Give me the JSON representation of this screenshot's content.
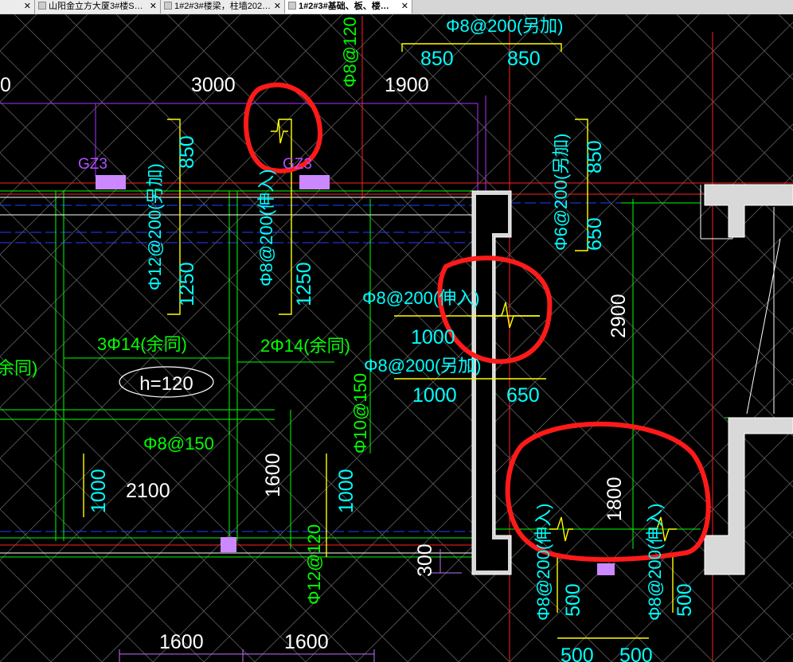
{
  "tabs": [
    {
      "label": "",
      "active": false
    },
    {
      "label": "山阳金立方大厦3#楼S…",
      "active": false
    },
    {
      "label": "1#2#3#楼梁，柱墙202…",
      "active": false
    },
    {
      "label": "1#2#3#基础、板、楼…",
      "active": false
    }
  ],
  "close_glyph": "✕",
  "dims": {
    "d0": "0",
    "d3000": "3000",
    "d1900": "1900",
    "d850a": "850",
    "d850b": "850",
    "d850c": "850",
    "d850d": "850",
    "d1250a": "1250",
    "d1250b": "1250",
    "d650a": "650",
    "d2900": "2900",
    "d1000a": "1000",
    "d1000b": "1000",
    "d650b": "650",
    "d2100": "2100",
    "d1600v": "1600",
    "d1000c": "1000",
    "d1000d": "1000",
    "d1800": "1800",
    "d300": "300",
    "d500a": "500",
    "d500b": "500",
    "d1600a": "1600",
    "d1600b": "1600",
    "d500c": "500",
    "d500d": "500"
  },
  "rebar": {
    "top_add": "Φ8@200(另加)",
    "top_v": "Φ8@120",
    "left_v": "Φ12@200(另加)",
    "mid_v": "Φ8@200(伸入)",
    "right_v": "Φ6@200(另加)",
    "mid_in": "Φ8@200(伸入)",
    "mid_add": "Φ8@200(另加)",
    "three": "3Φ14(余同)",
    "two": "2Φ14(余同)",
    "left_edge": "余同)",
    "phi150": "Φ8@150",
    "phi10": "Φ10@150",
    "phi12": "Φ12@120",
    "bot_left": "Φ8@200(伸入)",
    "bot_right": "Φ8@200(伸入)"
  },
  "labels": {
    "gz3a": "GZ3",
    "gz3b": "GZ3",
    "h": "h=120"
  },
  "colors": {
    "background": "#000000",
    "rebar_text": "#00ff00",
    "dimension": "#00ffff",
    "annotation": "#ffff00",
    "column": "#cc88ff",
    "wall": "#d9d9d9",
    "red_axis": "#ff2020",
    "highlight_circle": "#ff1a1a"
  }
}
